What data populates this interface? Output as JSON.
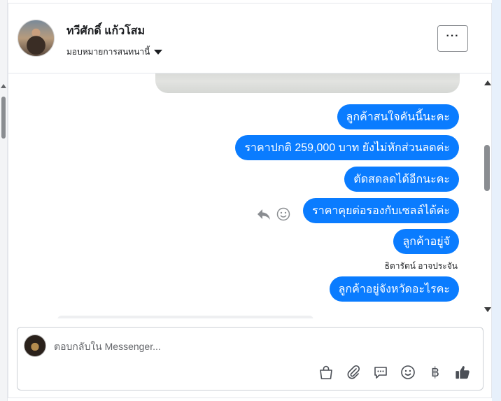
{
  "header": {
    "name": "ทวีศักดิ์ แก้วโสม",
    "assign_label": "มอบหมายการสนทนานี้",
    "more_label": "···"
  },
  "messages": [
    {
      "text": "ลูกค้าสนใจคันนี้นะคะ"
    },
    {
      "text": "ราคาปกติ 259,000 บาท ยังไม่หักส่วนลดค่ะ"
    },
    {
      "text": "ตัดสดลดได้อีกนะคะ"
    },
    {
      "text": "ราคาคุยต่อรองกับเซลล์ได้ค่ะ"
    },
    {
      "text": "ลูกค้าอยู่จั"
    },
    {
      "text": "ลูกค้าอยู่จังหวัดอะไรคะ"
    }
  ],
  "sender_label": "ธิดารัตน์ อาจประจัน",
  "composer": {
    "placeholder": "ตอบกลับใน Messenger...",
    "baht_symbol": "฿"
  },
  "icons": [
    "reply-icon",
    "emoji-react-icon",
    "shopping-bag-icon",
    "attachment-icon",
    "chat-icon",
    "emoji-icon",
    "baht-icon",
    "like-icon"
  ],
  "colors": {
    "bubble": "#0a7cff",
    "text": "#1c1e21",
    "icon": "#4b4f56"
  }
}
